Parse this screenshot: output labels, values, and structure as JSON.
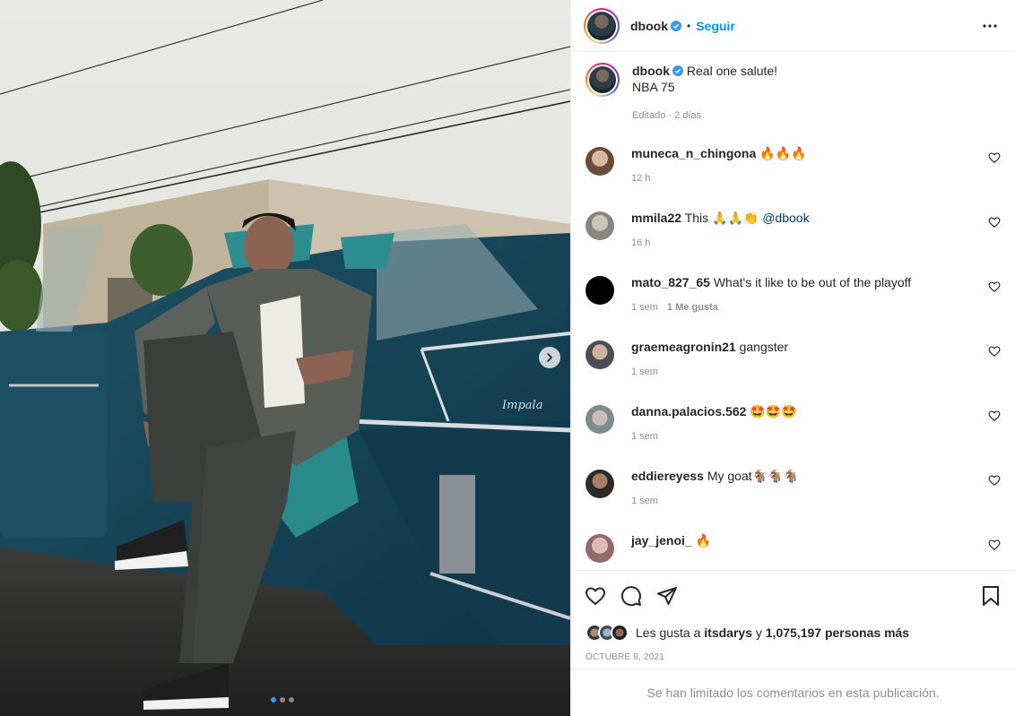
{
  "post": {
    "author": "dbook",
    "follow_label": "Seguir",
    "separator": "•",
    "caption_line1": "Real one salute!",
    "caption_line2": "NBA 75",
    "caption_meta": "Editado · 2 días",
    "likes_prefix": "Les gusta a",
    "likes_user": "itsdarys",
    "likes_joiner": "y",
    "likes_count": "1,075,197 personas más",
    "date": "OCTUBRE 8, 2021",
    "comments_limited": "Se han limitado los comentarios en esta publicación."
  },
  "media": {
    "slide_count": 3,
    "active_slide": 1,
    "car_badge": "Impala"
  },
  "comments": [
    {
      "user": "muneca_n_chingona",
      "text": "🔥🔥🔥",
      "time": "12 h",
      "likes": ""
    },
    {
      "user": "mmila22",
      "text": "This 🙏🙏👏",
      "mention": "@dbook",
      "time": "16 h",
      "likes": ""
    },
    {
      "user": "mato_827_65",
      "text": "What's it like to be out of the playoff",
      "time": "1 sem",
      "likes": "1 Me gusta"
    },
    {
      "user": "graemeagronin21",
      "text": "gangster",
      "time": "1 sem",
      "likes": ""
    },
    {
      "user": "danna.palacios.562",
      "text": "🤩🤩🤩",
      "time": "1 sem",
      "likes": ""
    },
    {
      "user": "eddiereyess",
      "text": "My goat🐐🐐🐐",
      "time": "1 sem",
      "likes": ""
    },
    {
      "user": "jay_jenoi_",
      "text": "🔥",
      "time": "",
      "likes": ""
    }
  ],
  "colors": {
    "accent": "#0095f6",
    "verified": "#3897f0",
    "muted": "#8e8e8e"
  },
  "icons": [
    "more-options-icon",
    "verified-badge-icon",
    "heart-icon",
    "comment-icon",
    "share-icon",
    "bookmark-icon",
    "chevron-right-icon"
  ]
}
